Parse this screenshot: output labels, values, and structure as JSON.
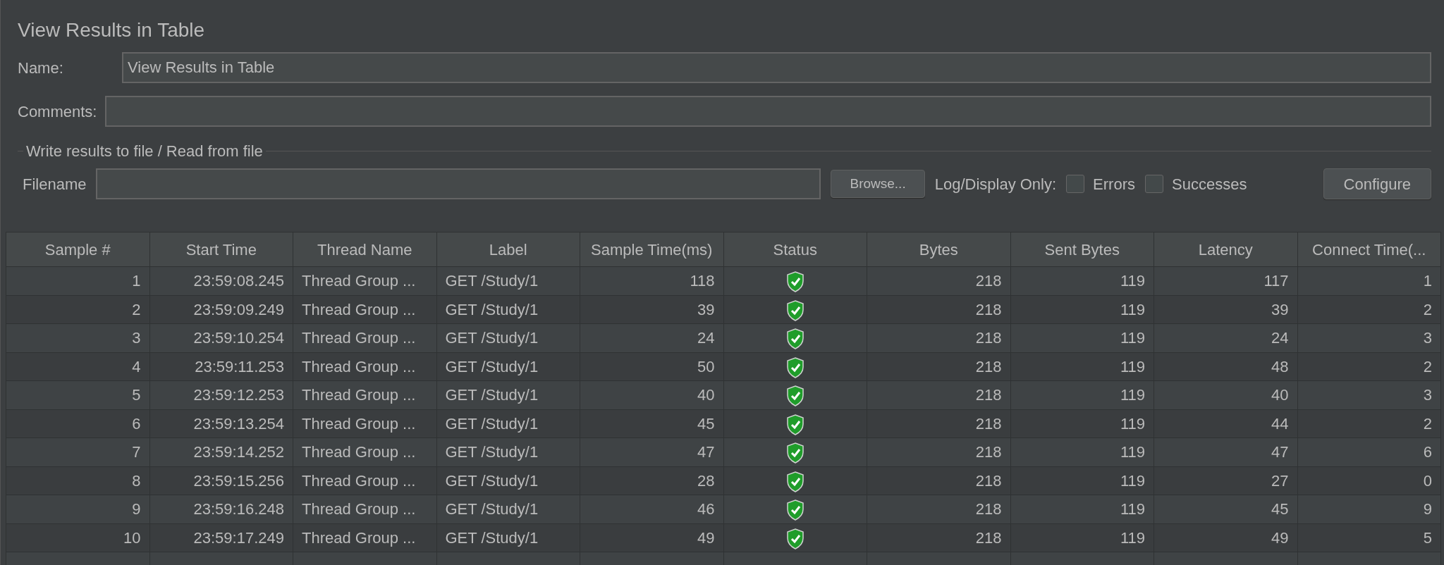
{
  "title": "View Results in Table",
  "name_field": {
    "label": "Name:",
    "value": "View Results in Table"
  },
  "comments_field": {
    "label": "Comments:"
  },
  "file_group": {
    "title": "Write results to file / Read from file",
    "filename_label": "Filename",
    "browse_button": "Browse...",
    "log_label": "Log/Display Only:",
    "checkboxes": [
      {
        "label": "Errors",
        "checked": false
      },
      {
        "label": "Successes",
        "checked": false
      }
    ],
    "configure_button": "Configure"
  },
  "table": {
    "columns": [
      "Sample #",
      "Start Time",
      "Thread Name",
      "Label",
      "Sample Time(ms)",
      "Status",
      "Bytes",
      "Sent Bytes",
      "Latency",
      "Connect Time(..."
    ],
    "rows": [
      {
        "cells": [
          "1",
          "23:59:08.245",
          "Thread Group ...",
          "GET /Study/1",
          "118",
          {
            "passed": true
          },
          "218",
          "119",
          "117",
          "1"
        ]
      },
      {
        "cells": [
          "2",
          "23:59:09.249",
          "Thread Group ...",
          "GET /Study/1",
          "39",
          {
            "passed": true
          },
          "218",
          "119",
          "39",
          "2"
        ]
      },
      {
        "cells": [
          "3",
          "23:59:10.254",
          "Thread Group ...",
          "GET /Study/1",
          "24",
          {
            "passed": true
          },
          "218",
          "119",
          "24",
          "3"
        ]
      },
      {
        "cells": [
          "4",
          "23:59:11.253",
          "Thread Group ...",
          "GET /Study/1",
          "50",
          {
            "passed": true
          },
          "218",
          "119",
          "48",
          "2"
        ]
      },
      {
        "cells": [
          "5",
          "23:59:12.253",
          "Thread Group ...",
          "GET /Study/1",
          "40",
          {
            "passed": true
          },
          "218",
          "119",
          "40",
          "3"
        ]
      },
      {
        "cells": [
          "6",
          "23:59:13.254",
          "Thread Group ...",
          "GET /Study/1",
          "45",
          {
            "passed": true
          },
          "218",
          "119",
          "44",
          "2"
        ]
      },
      {
        "cells": [
          "7",
          "23:59:14.252",
          "Thread Group ...",
          "GET /Study/1",
          "47",
          {
            "passed": true
          },
          "218",
          "119",
          "47",
          "6"
        ]
      },
      {
        "cells": [
          "8",
          "23:59:15.256",
          "Thread Group ...",
          "GET /Study/1",
          "28",
          {
            "passed": true
          },
          "218",
          "119",
          "27",
          "0"
        ]
      },
      {
        "cells": [
          "9",
          "23:59:16.248",
          "Thread Group ...",
          "GET /Study/1",
          "46",
          {
            "passed": true
          },
          "218",
          "119",
          "45",
          "9"
        ]
      },
      {
        "cells": [
          "10",
          "23:59:17.249",
          "Thread Group ...",
          "GET /Study/1",
          "49",
          {
            "passed": true
          },
          "218",
          "119",
          "49",
          "5"
        ]
      }
    ]
  }
}
